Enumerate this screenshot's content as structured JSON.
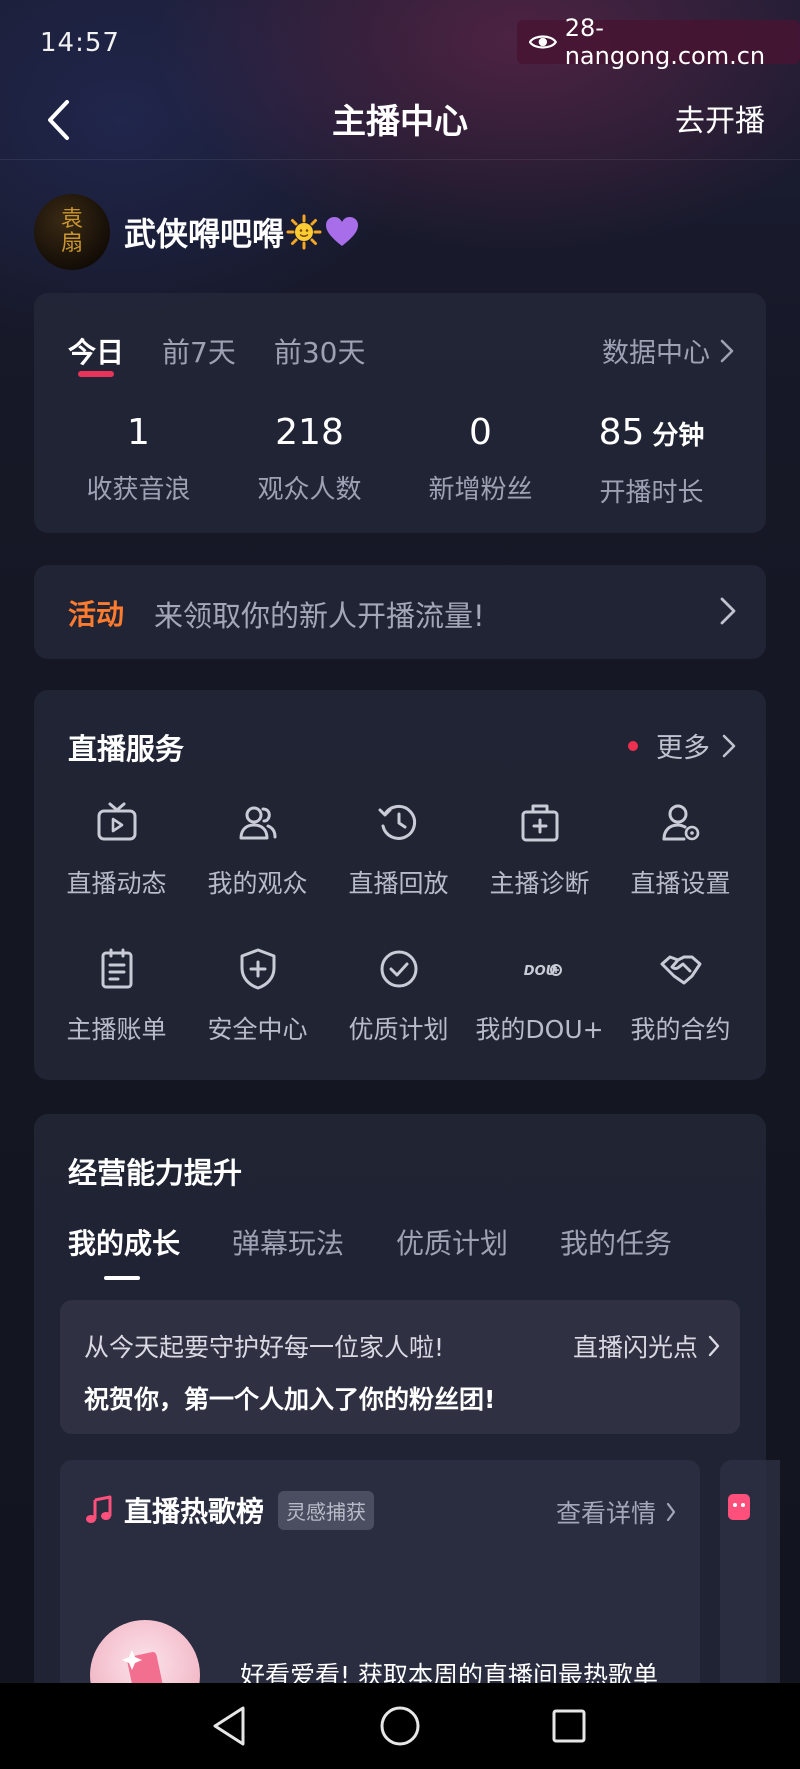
{
  "status_bar": {
    "time": "14:57",
    "watermark": "28-nangong.com.cn"
  },
  "nav": {
    "title": "主播中心",
    "action": "去开播"
  },
  "profile": {
    "name": "武侠嘚吧嘚",
    "avatar_text_top": "袁",
    "avatar_text_bottom": "扇"
  },
  "stats": {
    "tabs": [
      "今日",
      "前7天",
      "前30天"
    ],
    "active_tab": "今日",
    "data_center": "数据中心",
    "items": [
      {
        "value": "1",
        "unit": "",
        "label": "收获音浪"
      },
      {
        "value": "218",
        "unit": "",
        "label": "观众人数"
      },
      {
        "value": "0",
        "unit": "",
        "label": "新增粉丝"
      },
      {
        "value": "85",
        "unit": "分钟",
        "label": "开播时长"
      }
    ]
  },
  "activity": {
    "tag": "活动",
    "text": "来领取你的新人开播流量!"
  },
  "services": {
    "title": "直播服务",
    "more": "更多",
    "items": [
      {
        "label": "直播动态",
        "icon": "tv-play-icon"
      },
      {
        "label": "我的观众",
        "icon": "users-icon"
      },
      {
        "label": "直播回放",
        "icon": "history-clock-icon"
      },
      {
        "label": "主播诊断",
        "icon": "medical-kit-icon"
      },
      {
        "label": "直播设置",
        "icon": "user-settings-icon"
      },
      {
        "label": "主播账单",
        "icon": "bill-icon"
      },
      {
        "label": "安全中心",
        "icon": "shield-plus-icon"
      },
      {
        "label": "优质计划",
        "icon": "check-circle-icon"
      },
      {
        "label": "我的DOU+",
        "icon": "dou-plus-icon"
      },
      {
        "label": "我的合约",
        "icon": "handshake-icon"
      }
    ]
  },
  "business": {
    "title": "经营能力提升",
    "tabs": [
      "我的成长",
      "弹幕玩法",
      "优质计划",
      "我的任务"
    ],
    "active_tab": "我的成长",
    "notice": {
      "line1": "从今天起要守护好每一位家人啦!",
      "line2": "祝贺你，第一个人加入了你的粉丝团!",
      "link": "直播闪光点"
    },
    "hot_songs": {
      "title": "直播热歌榜",
      "badge": "灵感捕获",
      "detail": "查看详情",
      "desc": "好看爱看! 获取本周的直播间最热歌单"
    }
  },
  "colors": {
    "accent_red": "#e8345a",
    "activity_orange": "#ff7b2e",
    "background": "#121420"
  }
}
